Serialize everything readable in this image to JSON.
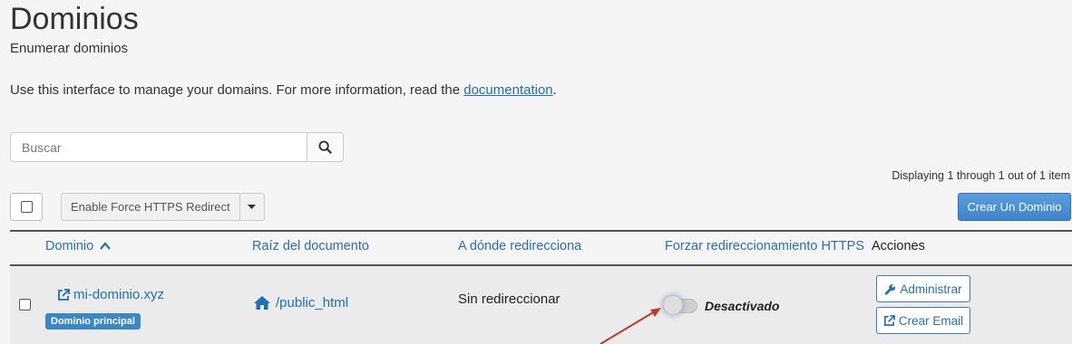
{
  "page": {
    "title": "Dominios",
    "subtitle": "Enumerar dominios",
    "intro_text": "Use this interface to manage your domains. For more information, read the ",
    "intro_link": "documentation",
    "intro_end": "."
  },
  "search": {
    "placeholder": "Buscar",
    "icon": "search-icon"
  },
  "pagination": {
    "displaying": "Displaying 1 through 1 out of 1 item"
  },
  "toolbar": {
    "bulk_action_label": "Enable Force HTTPS Redirect",
    "create_label": "Crear Un Dominio"
  },
  "table": {
    "headers": {
      "domain": "Dominio",
      "docroot": "Raíz del documento",
      "redirect": "A dónde redirecciona",
      "https": "Forzar redireccionamiento HTTPS",
      "actions": "Acciones"
    },
    "rows": [
      {
        "domain": "mi-dominio.xyz",
        "badge": "Dominio principal",
        "docroot": "/public_html",
        "redirect": "Sin redireccionar",
        "https_status": "Desactivado",
        "https_enabled": false,
        "actions": {
          "manage": "Administrar",
          "create_email": "Crear Email"
        }
      }
    ]
  },
  "colors": {
    "link": "#1f6fb3",
    "primary_button": "#4a90d9",
    "badge": "#3a87c4",
    "annotation_arrow": "#c0392b"
  }
}
